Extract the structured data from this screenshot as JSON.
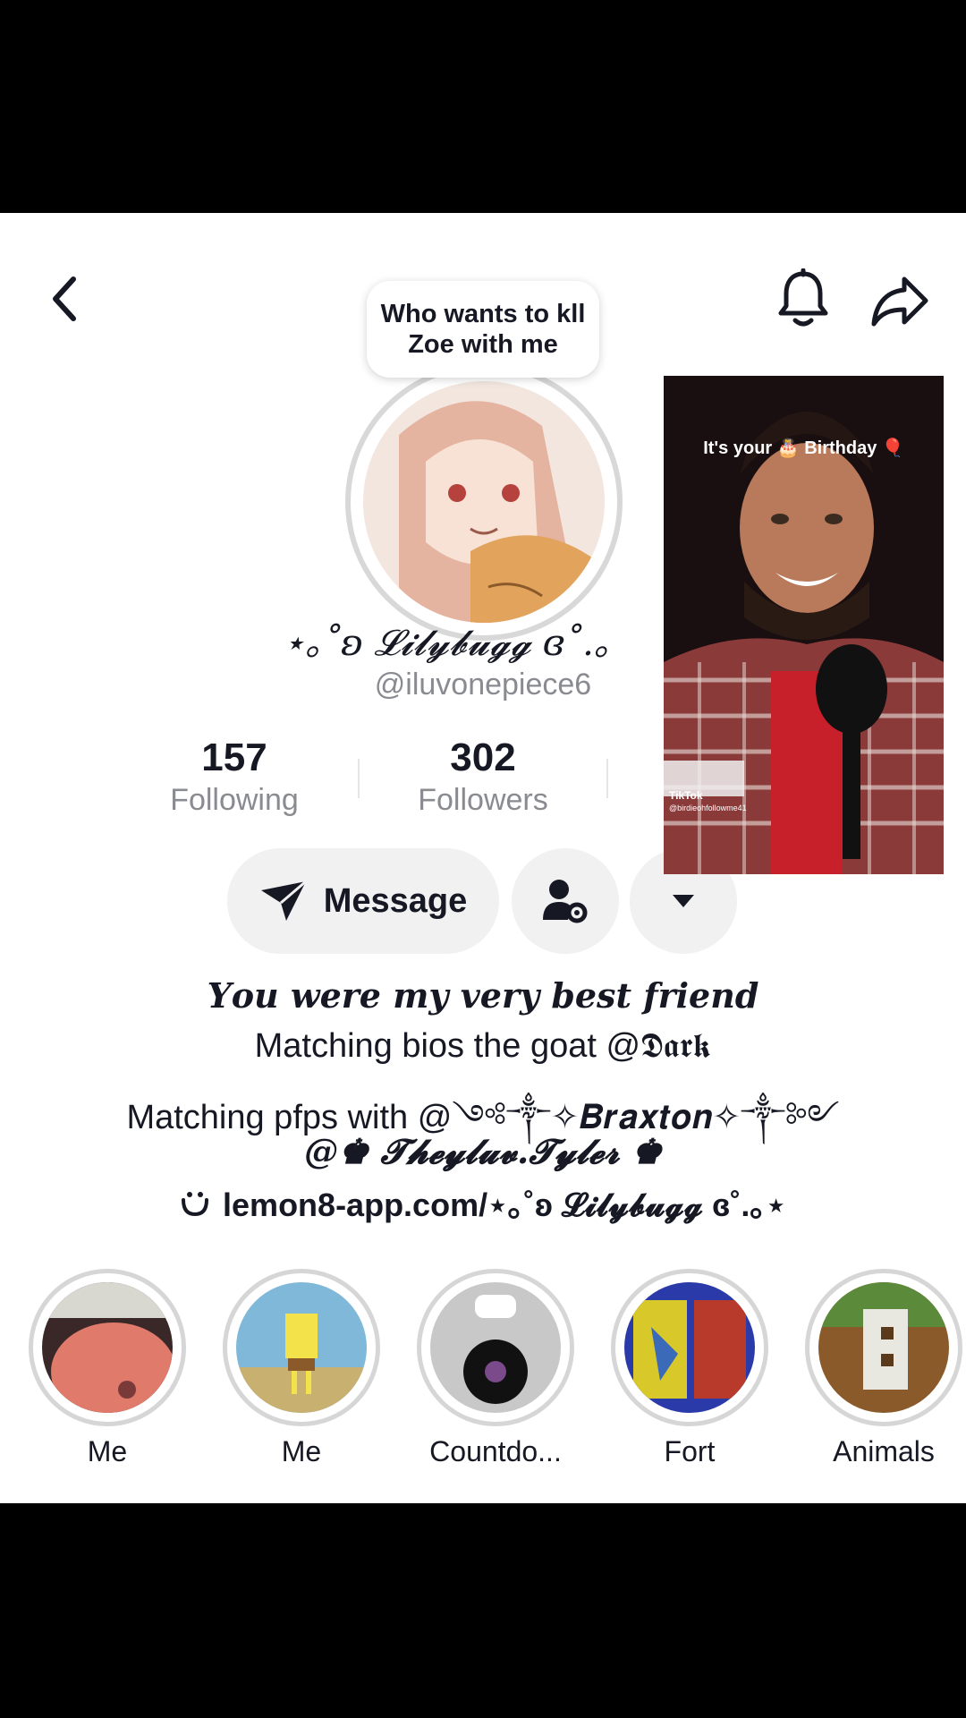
{
  "header": {
    "back_icon": "chevron-left-icon",
    "bell_icon": "bell-icon",
    "share_icon": "share-arrow-icon"
  },
  "profile": {
    "note": "Who wants to kll Zoe with me",
    "display_name": "⋆｡˚ʚ 𝓛𝓲𝓵𝔂𝓫𝓾𝓰𝓰 ɞ˚.｡",
    "handle": "@iluvonepiece6"
  },
  "stats": [
    {
      "value": "157",
      "label": "Following"
    },
    {
      "value": "302",
      "label": "Followers"
    }
  ],
  "actions": {
    "message_label": "Message",
    "add_friend_icon": "person-gear-icon",
    "more_icon": "caret-down-icon"
  },
  "bio": {
    "line1": "𝒀𝒐𝒖 𝒘𝒆𝒓𝒆 𝒎𝒚 𝒗𝒆𝒓𝒚 𝒃𝒆𝒔𝒕 𝒇𝒓𝒊𝒆𝒏𝒅",
    "line2": "Matching bios the goat @𝕯𝖆𝖗𝖐",
    "line3": "Matching pfps with @༺༒✧𝑩𝒓𝒂𝒙𝒕𝒐𝒏✧༒༻",
    "line4": "@♚ 𝓣𝓱𝓮𝔂𝓵𝓾𝓿.𝓣𝔂𝓵𝓮𝓻 ♚",
    "link_icon": "link-icon",
    "link": "lemon8-app.com/⋆｡˚ʚ 𝓛𝓲𝓵𝔂𝓫𝓾𝓰𝓰 ɞ˚.｡⋆"
  },
  "pip_video": {
    "caption": "It's your 🎂 Birthday 🎈",
    "watermark_brand": "TikTok",
    "watermark_user": "@birdieohfollowme41"
  },
  "highlights": [
    {
      "label": "Me"
    },
    {
      "label": "Me"
    },
    {
      "label": "Countdo..."
    },
    {
      "label": "Fort"
    },
    {
      "label": "Animals"
    }
  ],
  "colors": {
    "text_primary": "#161823",
    "text_secondary": "#8a8b91",
    "button_bg": "#f1f1f2",
    "bar_black": "#000000"
  }
}
